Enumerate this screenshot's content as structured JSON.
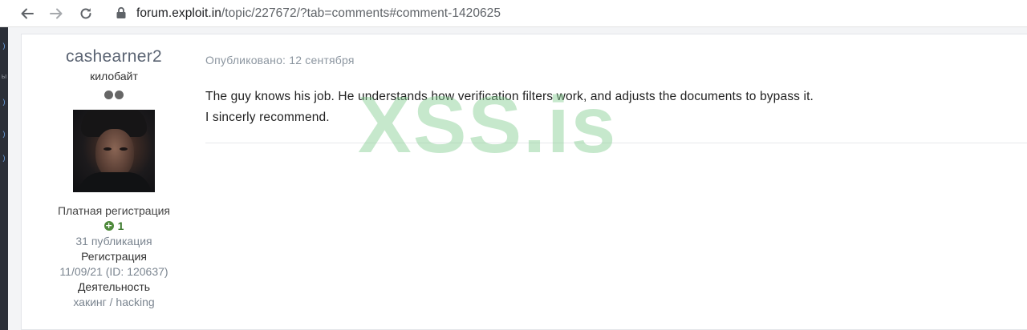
{
  "browser": {
    "url_host": "forum.exploit.in",
    "url_path": "/topic/227672/?tab=comments#comment-1420625"
  },
  "author": {
    "name": "cashearner2",
    "rank": "килобайт",
    "pips_count": 2,
    "group": "Платная регистрация",
    "reputation_icon": "plus-circle-icon",
    "reputation": "1",
    "posts": "31 публикация",
    "registration_label": "Регистрация",
    "registration_value": "11/09/21 (ID: 120637)",
    "activity_label": "Деятельность",
    "activity_value": "хакинг / hacking"
  },
  "post": {
    "published": "Опубликовано: 12 сентября",
    "lines": [
      "The guy knows his job. He understands how verification filters work, and adjusts the documents to bypass it.",
      "I sincerly recommend."
    ]
  },
  "watermark": "XSS.is",
  "colors": {
    "watermark": "#80cd8e",
    "reputation": "#3d7a2e",
    "muted": "#8c96a0"
  }
}
